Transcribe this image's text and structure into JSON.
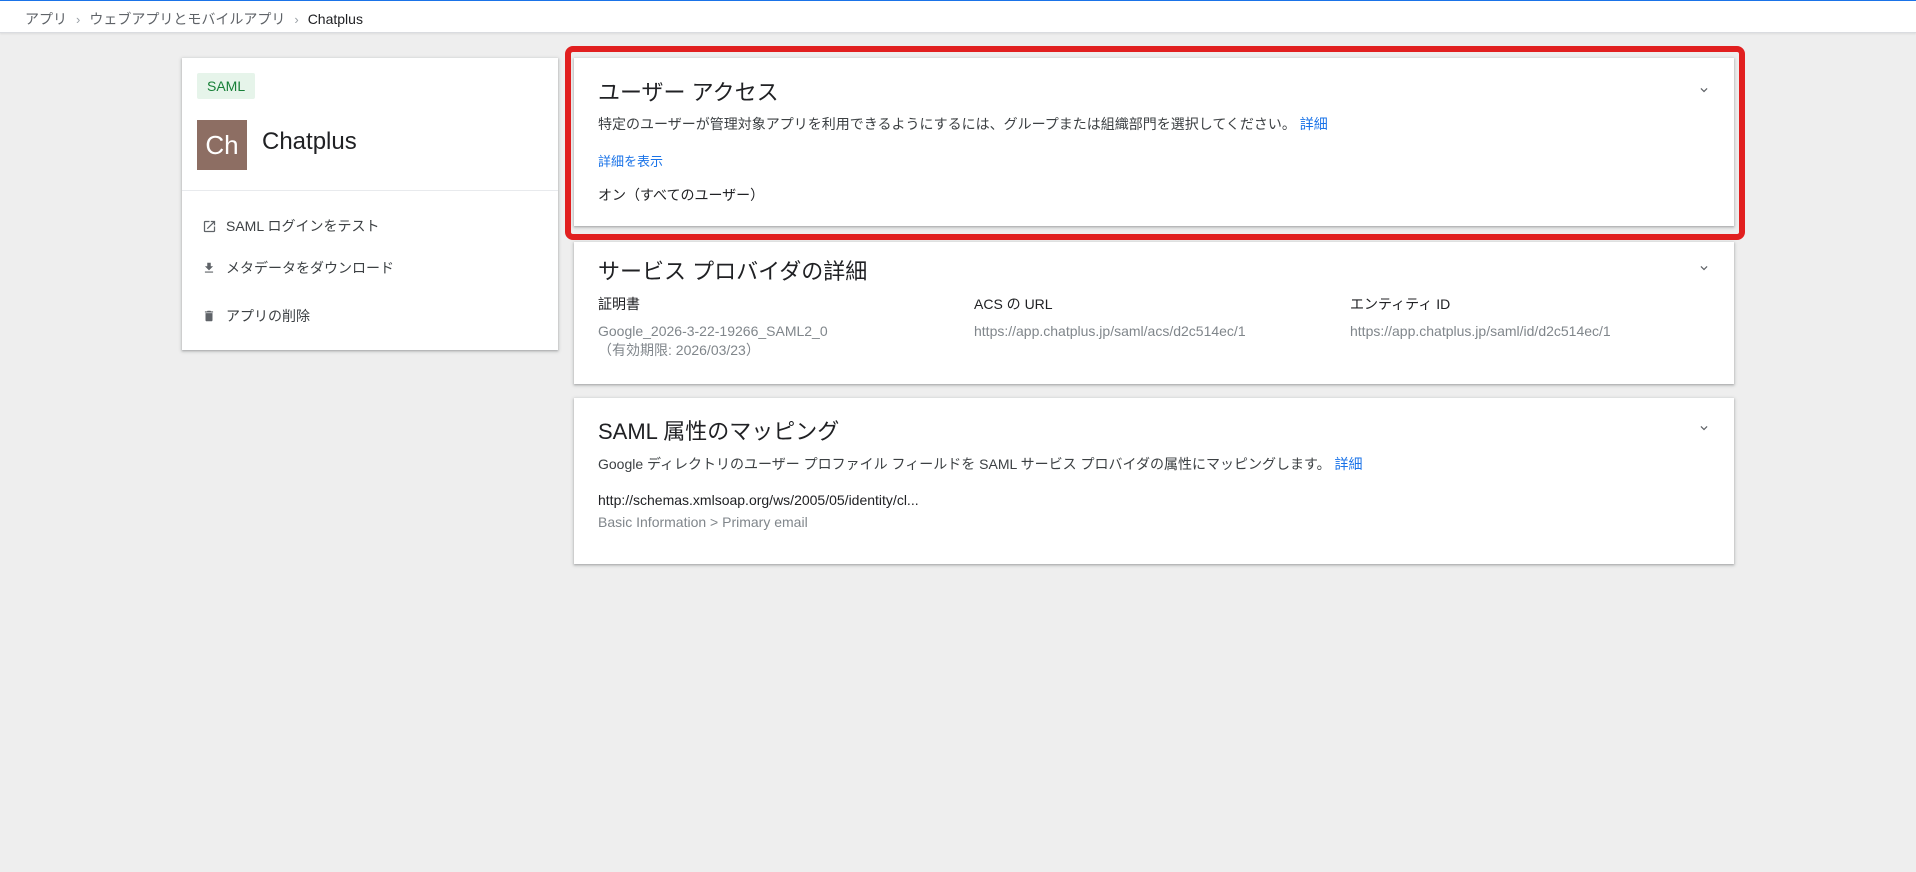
{
  "breadcrumb": {
    "items": [
      "アプリ",
      "ウェブアプリとモバイルアプリ"
    ],
    "current": "Chatplus"
  },
  "app": {
    "badge": "SAML",
    "avatar_text": "Ch",
    "name": "Chatplus",
    "avatar_color": "#8d6e63",
    "menu": [
      {
        "label": "SAML ログインをテスト",
        "icon": "open-in-new-icon"
      },
      {
        "label": "メタデータをダウンロード",
        "icon": "download-icon"
      },
      {
        "label": "アプリの削除",
        "icon": "trash-icon"
      }
    ]
  },
  "user_access": {
    "title": "ユーザー アクセス",
    "description": "特定のユーザーが管理対象アプリを利用できるようにするには、グループまたは組織部門を選択してください。",
    "learn_more": "詳細",
    "show_details": "詳細を表示",
    "status": "オン（すべてのユーザー）"
  },
  "service_provider": {
    "title": "サービス プロバイダの詳細",
    "certificate_label": "証明書",
    "certificate_value": "Google_2026-3-22-19266_SAML2_0",
    "certificate_expiry": "（有効期限: 2026/03/23）",
    "acs_label": "ACS の URL",
    "acs_value": "https://app.chatplus.jp/saml/acs/d2c514ec/1",
    "entity_label": "エンティティ ID",
    "entity_value": "https://app.chatplus.jp/saml/id/d2c514ec/1"
  },
  "attribute_mapping": {
    "title": "SAML 属性のマッピング",
    "description": "Google ディレクトリのユーザー プロファイル フィールドを SAML サービス プロバイダの属性にマッピングします。",
    "learn_more": "詳細",
    "attribute": "http://schemas.xmlsoap.org/ws/2005/05/identity/cl...",
    "mapped_to": "Basic Information > Primary email"
  },
  "colors": {
    "highlight": "#e11f1f",
    "link": "#1a73e8",
    "badge_bg": "#e6f4ea",
    "badge_text": "#188038"
  }
}
